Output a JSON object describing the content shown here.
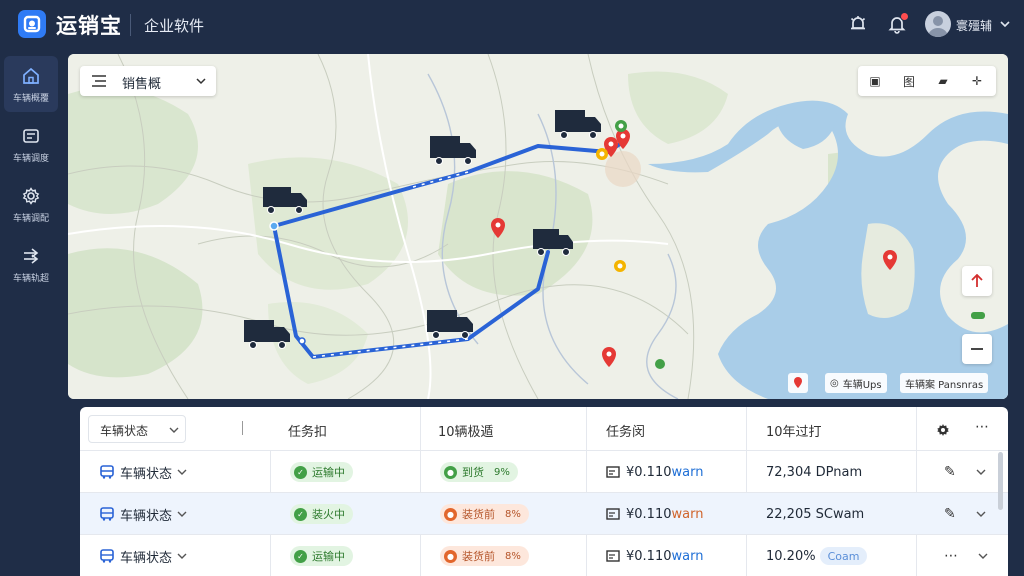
{
  "app": {
    "logo_text": "运销宝",
    "subtitle": "企业软件",
    "user_name": "寰殭辅"
  },
  "sidebar": {
    "items": [
      {
        "label": "车辆概覆",
        "icon": "home-icon",
        "active": true
      },
      {
        "label": "车辆调度",
        "icon": "dispatch-icon",
        "active": false
      },
      {
        "label": "车辆调配",
        "icon": "gear-icon",
        "active": false
      },
      {
        "label": "车辆轨超",
        "icon": "arrow-right-icon",
        "active": false
      }
    ]
  },
  "map": {
    "layer_label": "销售概",
    "tools": [
      "▣",
      "图",
      "▰",
      "✛"
    ],
    "attrib_short": "车辆Ups",
    "attrib_long": "车辆案 Pansnras",
    "route_color": "#2a63d6",
    "water_color": "#a9cde8"
  },
  "table": {
    "filter_label": "车辆状态",
    "headers": [
      "任务扣",
      "10辆极遁",
      "任务闵",
      "10年过打"
    ],
    "rows": [
      {
        "vehicle": "车辆状态",
        "task_status": "运输中",
        "progress_label": "到货",
        "progress_pct": "9%",
        "progress_color": "green",
        "eta": "¥0.110warn",
        "eta_color": "blue",
        "value": "72,304 DPnam",
        "value_badge": ""
      },
      {
        "vehicle": "车辆状态",
        "task_status": "装火中",
        "progress_label": "装货前",
        "progress_pct": "8%",
        "progress_color": "orange",
        "eta": "¥0.110warn",
        "eta_color": "orange",
        "value": "22,205 SCwam",
        "value_badge": ""
      },
      {
        "vehicle": "车辆状态",
        "task_status": "运输中",
        "progress_label": "装货前",
        "progress_pct": "8%",
        "progress_color": "orange",
        "eta": "¥0.110warn",
        "eta_color": "blue",
        "value": "10.20%",
        "value_badge": "Coam"
      }
    ]
  }
}
